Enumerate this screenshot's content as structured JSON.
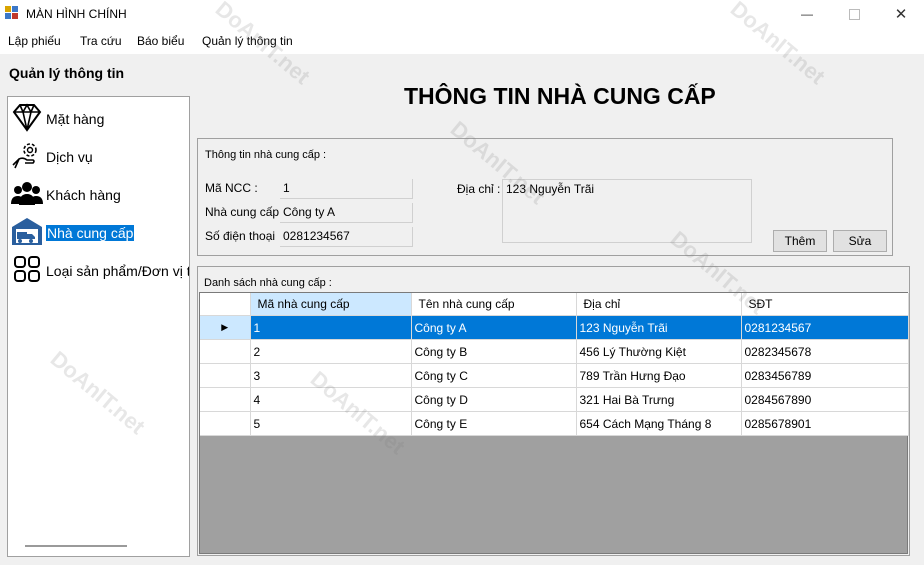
{
  "window": {
    "title": "MÀN HÌNH CHÍNH"
  },
  "menu": [
    "Lập phiếu",
    "Tra cứu",
    "Báo biểu",
    "Quản lý thông tin"
  ],
  "sidebar": {
    "title": "Quản lý thông tin",
    "items": [
      {
        "label": "Mặt hàng",
        "icon": "diamond-icon"
      },
      {
        "label": "Dịch vụ",
        "icon": "service-hand-icon"
      },
      {
        "label": "Khách hàng",
        "icon": "customers-icon"
      },
      {
        "label": "Nhà cung cấp",
        "icon": "warehouse-truck-icon",
        "selected": true
      },
      {
        "label": "Loại sản phẩm/Đơn vị t",
        "icon": "categories-icon"
      }
    ]
  },
  "page": {
    "title": "THÔNG TIN NHÀ CUNG CẤP"
  },
  "info": {
    "caption": "Thông tin nhà cung cấp :",
    "ma_ncc_label": "Mã NCC :",
    "ma_ncc_value": "1",
    "ten_label": "Nhà cung cấp :",
    "ten_value": "Công ty A",
    "sdt_label": "Số điện thoại",
    "sdt_value": "0281234567",
    "diachi_label": "Địa chỉ :",
    "diachi_value": "123 Nguyễn Trãi",
    "add_button": "Thêm",
    "edit_button": "Sửa"
  },
  "list": {
    "caption": "Danh sách nhà cung cấp :",
    "columns": [
      "Mã nhà cung cấp",
      "Tên nhà cung cấp",
      "Địa chỉ",
      "SĐT"
    ],
    "rows": [
      [
        "1",
        "Công ty A",
        "123 Nguyễn Trãi",
        "0281234567"
      ],
      [
        "2",
        "Công ty B",
        "456 Lý Thường Kiệt",
        "0282345678"
      ],
      [
        "3",
        "Công ty C",
        "789 Trần Hưng Đạo",
        "0283456789"
      ],
      [
        "4",
        "Công ty D",
        "321 Hai Bà Trưng",
        "0284567890"
      ],
      [
        "5",
        "Công ty E",
        "654 Cách Mạng Tháng 8",
        "0285678901"
      ]
    ],
    "selected_row": 0
  },
  "watermark": "DoAnIT.net",
  "colors": {
    "selection": "#0078d7",
    "header_selected": "#cce8ff",
    "grid_empty": "#a0a0a0"
  }
}
